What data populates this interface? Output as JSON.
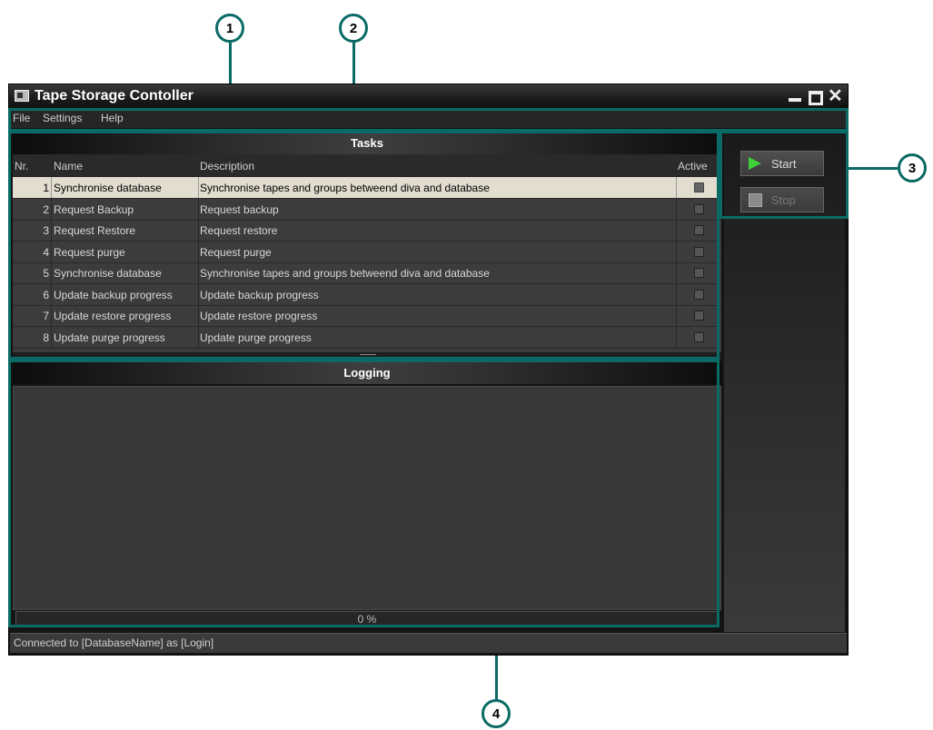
{
  "window": {
    "title": "Tape Storage Contoller"
  },
  "menu": [
    "File",
    "Settings",
    "Help"
  ],
  "tasks": {
    "header": "Tasks",
    "columns": {
      "nr": "Nr.",
      "name": "Name",
      "description": "Description",
      "active": "Active"
    },
    "rows": [
      {
        "nr": "1",
        "name": "Synchronise database",
        "description": "Synchronise tapes and groups betweend diva and database",
        "selected": true
      },
      {
        "nr": "2",
        "name": "Request Backup",
        "description": "Request backup"
      },
      {
        "nr": "3",
        "name": "Request Restore",
        "description": "Request restore"
      },
      {
        "nr": "4",
        "name": "Request purge",
        "description": "Request purge"
      },
      {
        "nr": "5",
        "name": "Synchronise database",
        "description": "Synchronise tapes and groups betweend diva and database"
      },
      {
        "nr": "6",
        "name": "Update backup progress",
        "description": "Update backup progress"
      },
      {
        "nr": "7",
        "name": "Update restore progress",
        "description": "Update restore progress"
      },
      {
        "nr": "8",
        "name": "Update purge progress",
        "description": "Update purge progress"
      }
    ]
  },
  "logging": {
    "header": "Logging",
    "progress_text": "0 %",
    "progress_fraction": 0
  },
  "buttons": {
    "start": "Start",
    "stop": "Stop"
  },
  "status": "Connected to [DatabaseName] as [Login]",
  "callouts": [
    "1",
    "2",
    "3",
    "4"
  ],
  "colors": {
    "accent": "#0a6b66",
    "play": "#3fd03a",
    "selected_row": "#e3ddd0"
  }
}
